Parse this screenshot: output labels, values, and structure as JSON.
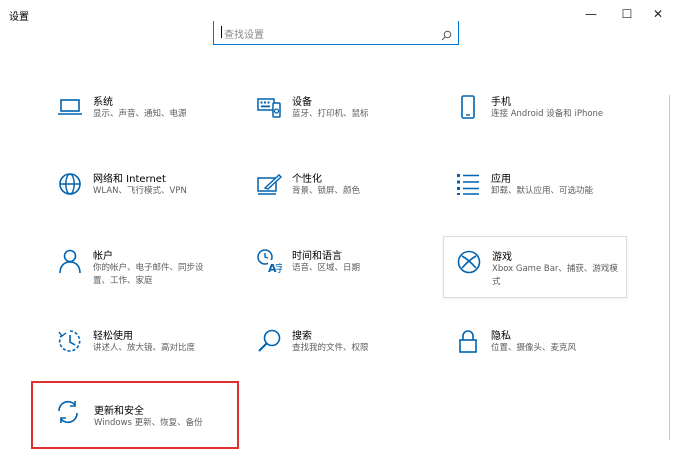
{
  "window": {
    "title": "设置",
    "minimize": "—",
    "maximize": "☐",
    "close": "✕"
  },
  "search": {
    "placeholder": "查找设置"
  },
  "colors": {
    "accent": "#0078d7",
    "highlight_border": "#e03030"
  },
  "tiles": [
    {
      "name": "系统",
      "desc": "显示、声音、通知、电源",
      "icon": "laptop-icon"
    },
    {
      "name": "设备",
      "desc": "蓝牙、打印机、鼠标",
      "icon": "keyboard-icon"
    },
    {
      "name": "手机",
      "desc": "连接 Android 设备和 iPhone",
      "icon": "phone-icon"
    },
    {
      "name": "网络和 Internet",
      "desc": "WLAN、飞行模式、VPN",
      "icon": "globe-icon"
    },
    {
      "name": "个性化",
      "desc": "背景、锁屏、颜色",
      "icon": "paint-brush-icon"
    },
    {
      "name": "应用",
      "desc": "卸载、默认应用、可选功能",
      "icon": "app-list-icon"
    },
    {
      "name": "帐户",
      "desc": "你的帐户、电子邮件、同步设置、工作、家庭",
      "icon": "person-icon"
    },
    {
      "name": "时间和语言",
      "desc": "语音、区域、日期",
      "icon": "time-language-icon"
    },
    {
      "name": "游戏",
      "desc": "Xbox Game Bar、捕获、游戏模式",
      "icon": "xbox-icon"
    },
    {
      "name": "轻松使用",
      "desc": "讲述人、放大镜、高对比度",
      "icon": "ease-of-access-icon"
    },
    {
      "name": "搜索",
      "desc": "查找我的文件、权限",
      "icon": "search-icon"
    },
    {
      "name": "隐私",
      "desc": "位置、摄像头、麦克风",
      "icon": "lock-icon"
    },
    {
      "name": "更新和安全",
      "desc": "Windows 更新、恢复、备份",
      "icon": "sync-icon"
    }
  ]
}
